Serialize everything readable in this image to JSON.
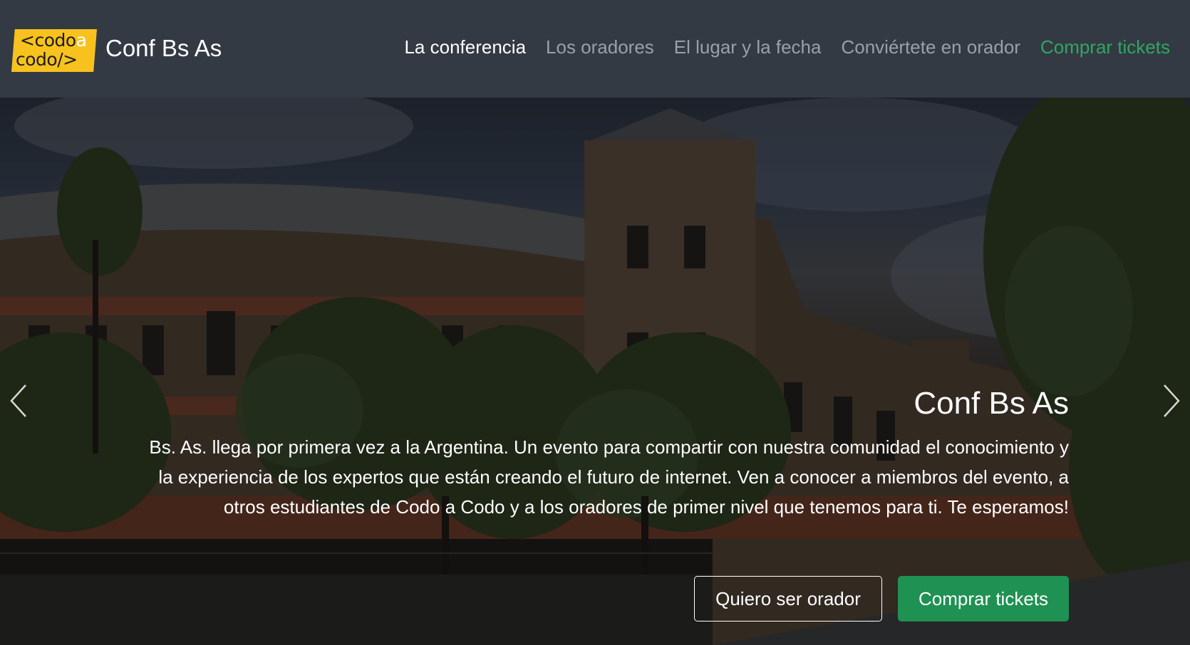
{
  "navbar": {
    "logo_line1": "<codo",
    "logo_line1_accent": "a",
    "logo_line2": "codo/>",
    "brand_title": "Conf Bs As",
    "links": [
      {
        "label": "La conferencia",
        "state": "active"
      },
      {
        "label": "Los oradores",
        "state": "default"
      },
      {
        "label": "El lugar y la fecha",
        "state": "default"
      },
      {
        "label": "Conviértete en orador",
        "state": "default"
      },
      {
        "label": "Comprar tickets",
        "state": "cta"
      }
    ]
  },
  "hero": {
    "image_subject": "building-photo",
    "title": "Conf Bs As",
    "description": "Bs. As. llega por primera vez a la Argentina. Un evento para compartir con nuestra comunidad el conocimiento y la experiencia de los expertos que están creando el futuro de internet. Ven a conocer a miembros del evento, a otros estudiantes de Codo a Codo y a los oradores de primer nivel que tenemos para ti. Te esperamos!",
    "buttons": {
      "speaker": "Quiero ser orador",
      "tickets": "Comprar tickets"
    },
    "prev_icon": "chevron-left-icon",
    "next_icon": "chevron-right-icon"
  },
  "colors": {
    "navbar_bg": "#343a44",
    "nav_active": "#ffffff",
    "nav_default": "#9aa0a8",
    "nav_cta": "#2ea85f",
    "logo_bg": "#f8c21e",
    "button_success": "#1f9152"
  }
}
